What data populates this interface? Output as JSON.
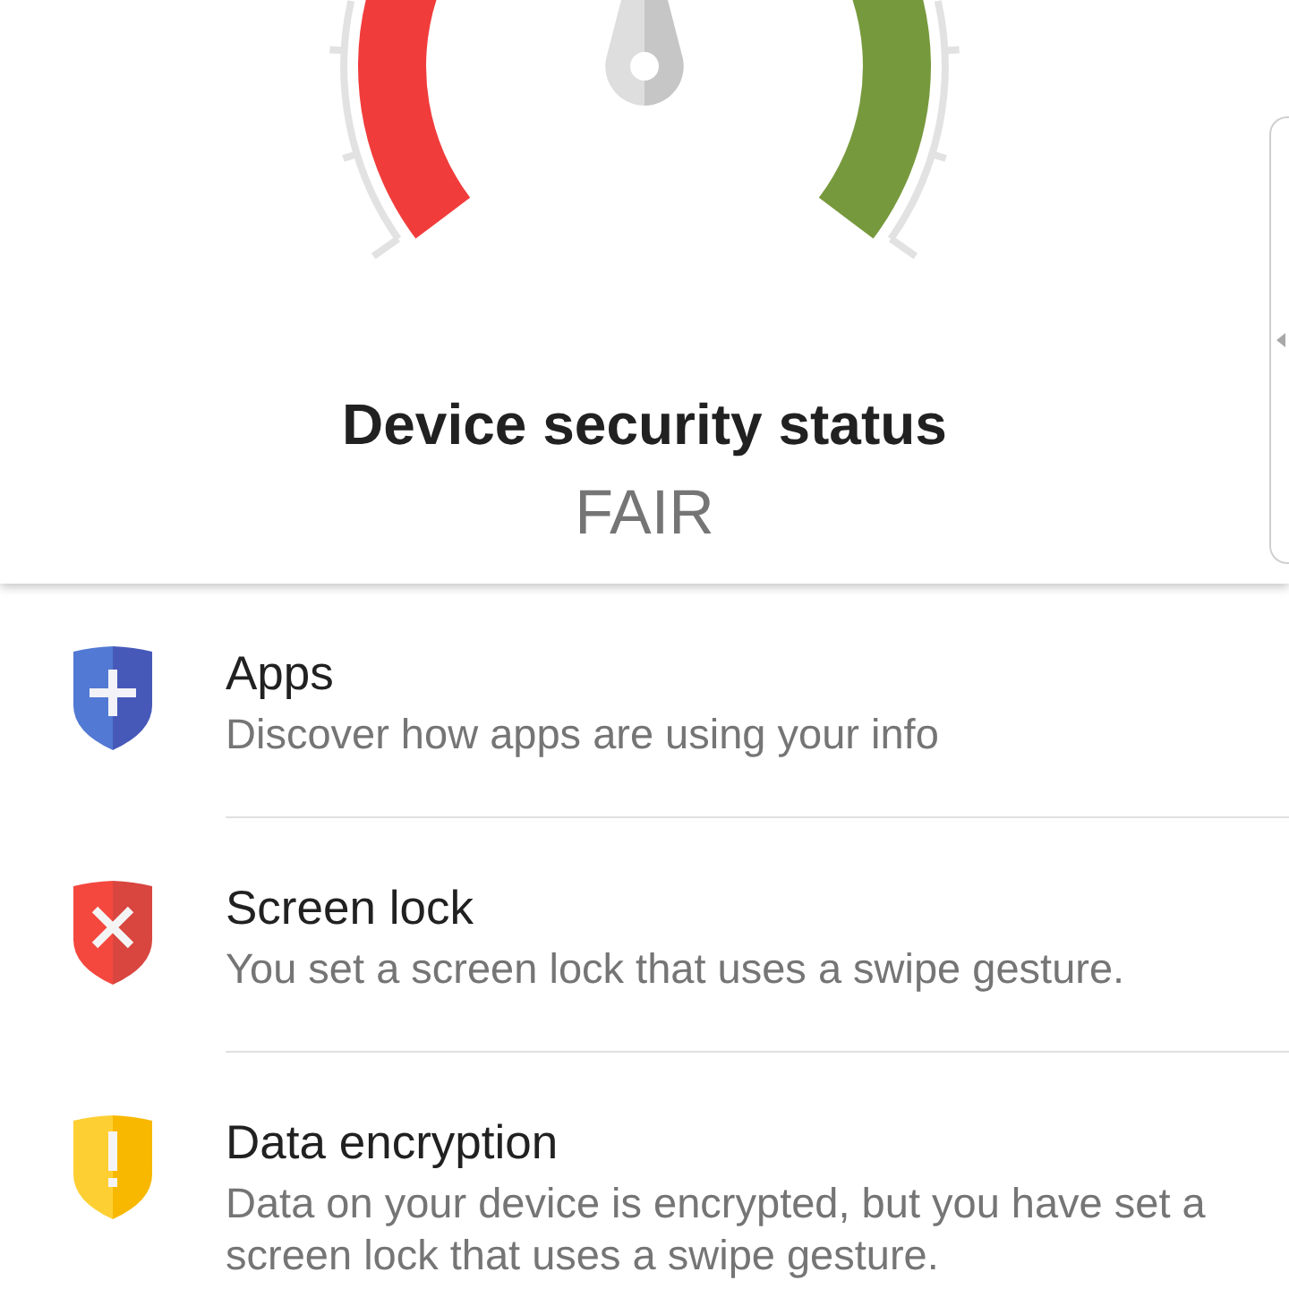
{
  "status_card": {
    "title": "Device security status",
    "status": "FAIR"
  },
  "items": [
    {
      "kind": "add",
      "title": "Apps",
      "description": "Discover how apps are using your info"
    },
    {
      "kind": "error",
      "title": "Screen lock",
      "description": "You set a screen lock that uses a swipe gesture."
    },
    {
      "kind": "warning",
      "title": "Data encryption",
      "description": "Data on your device is encrypted, but you have set a screen lock that uses a swipe gesture."
    }
  ]
}
